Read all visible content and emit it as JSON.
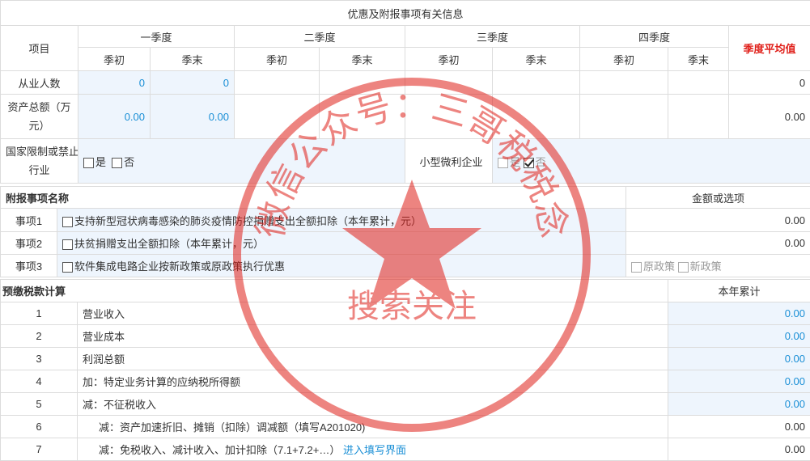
{
  "section_title": "优惠及附报事项有关信息",
  "quarter_table": {
    "item_header": "项目",
    "quarters": [
      "一季度",
      "二季度",
      "三季度",
      "四季度"
    ],
    "start_label": "季初",
    "end_label": "季末",
    "avg_label": "季度平均值",
    "rows": {
      "employees": {
        "label": "从业人数",
        "q1_start": "0",
        "q1_end": "0",
        "avg": "0"
      },
      "assets": {
        "label_line1": "资产总额（万",
        "label_line2": "元）",
        "q1_start": "0.00",
        "q1_end": "0.00",
        "avg": "0.00"
      }
    },
    "restricted": {
      "label_line1": "国家限制或禁止",
      "label_line2": "行业",
      "yes": "是",
      "no": "否"
    },
    "small_micro": {
      "label": "小型微利企业",
      "yes": "是",
      "no": "否"
    }
  },
  "attach_table": {
    "name_header": "附报事项名称",
    "amount_header": "金额或选项",
    "items": [
      {
        "label": "事项1",
        "desc": "支持新型冠状病毒感染的肺炎疫情防控捐赠支出全额扣除（本年累计，元）",
        "value": "0.00"
      },
      {
        "label": "事项2",
        "desc": "扶贫捐赠支出全额扣除（本年累计，元）",
        "value": "0.00"
      },
      {
        "label": "事项3",
        "desc": "软件集成电路企业按新政策或原政策执行优惠",
        "opt_old": "原政策",
        "opt_new": "新政策"
      }
    ]
  },
  "tax_table": {
    "header": "预缴税款计算",
    "col_header": "本年累计",
    "rows": [
      {
        "no": "1",
        "label": "营业收入",
        "value": "0.00"
      },
      {
        "no": "2",
        "label": "营业成本",
        "value": "0.00"
      },
      {
        "no": "3",
        "label": "利润总额",
        "value": "0.00"
      },
      {
        "no": "4",
        "label": "加：特定业务计算的应纳税所得额",
        "value": "0.00"
      },
      {
        "no": "5",
        "label": "减：不征税收入",
        "value": "0.00"
      },
      {
        "no": "6",
        "label": "减：资产加速折旧、摊销（扣除）调减额（填写A201020)",
        "value": "0.00"
      },
      {
        "no": "7",
        "label": "减：免税收入、减计收入、加计扣除（7.1+7.2+…）",
        "link": "进入填写界面",
        "value": "0.00"
      }
    ]
  },
  "watermark": {
    "top_text": "微信公众号：三哥税税念",
    "bottom_text": "搜索关注",
    "color": "#e0201a"
  }
}
